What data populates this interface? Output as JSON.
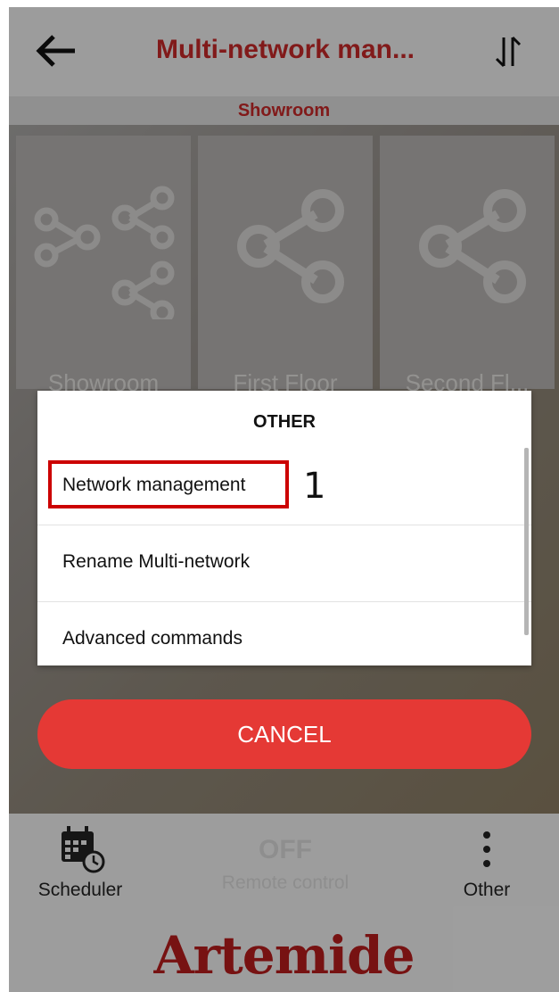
{
  "header": {
    "title": "Multi-network man...",
    "subtitle": "Showroom"
  },
  "tiles": [
    {
      "label": "Showroom",
      "icon": "multi-share-icon"
    },
    {
      "label": "First Floor",
      "icon": "share-icon"
    },
    {
      "label": "Second Fl...",
      "icon": "share-icon"
    }
  ],
  "bottom_nav": {
    "scheduler_label": "Scheduler",
    "remote_state": "OFF",
    "remote_label": "Remote control",
    "other_label": "Other"
  },
  "brand": "Artemide",
  "dialog": {
    "title": "OTHER",
    "items": [
      "Network management",
      "Rename Multi-network",
      "Advanced commands"
    ]
  },
  "cancel_label": "CANCEL",
  "annotation": {
    "number": "1"
  },
  "colors": {
    "accent": "#c62828",
    "cancel": "#e53935",
    "highlight": "#cc0000"
  }
}
